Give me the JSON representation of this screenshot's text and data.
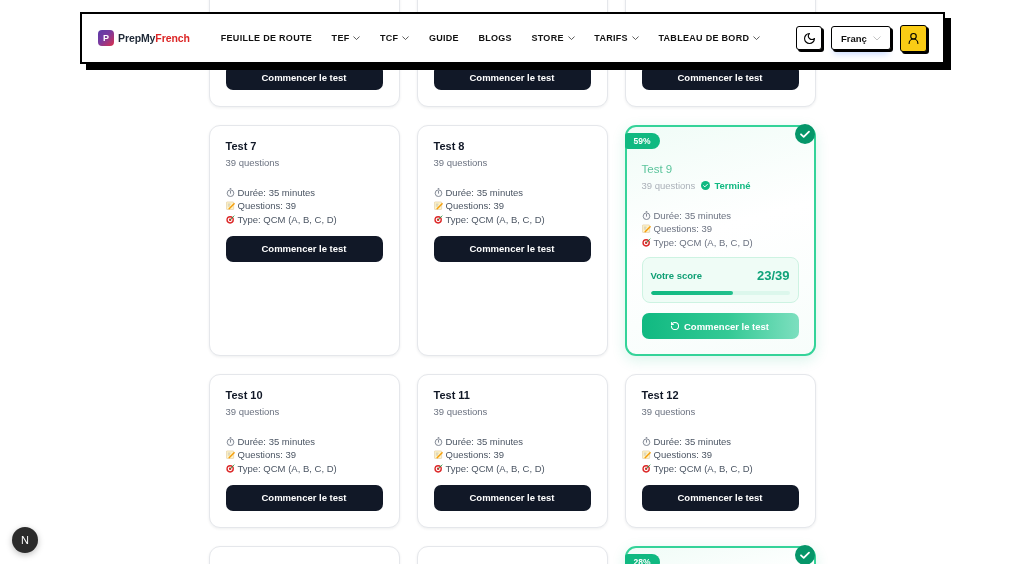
{
  "header": {
    "logo": {
      "mark": "P",
      "brand": "PrepMy",
      "brand_accent": "French"
    },
    "nav": [
      {
        "label": "FEUILLE DE ROUTE",
        "has_menu": false
      },
      {
        "label": "TEF",
        "has_menu": true
      },
      {
        "label": "TCF",
        "has_menu": true
      },
      {
        "label": "GUIDE",
        "has_menu": false
      },
      {
        "label": "BLOGS",
        "has_menu": false
      },
      {
        "label": "STORE",
        "has_menu": true
      },
      {
        "label": "TARIFS",
        "has_menu": true
      },
      {
        "label": "TABLEAU DE BORD",
        "has_menu": true
      }
    ],
    "language": {
      "value": "Franç"
    }
  },
  "tests": [
    {
      "kind": "cut_top",
      "completed": false,
      "button": "Commencer le test"
    },
    {
      "kind": "cut_top",
      "completed": false,
      "button": "Commencer le test"
    },
    {
      "kind": "cut_top",
      "completed": false,
      "button": "Commencer le test"
    },
    {
      "kind": "full",
      "completed": false,
      "title": "Test 7",
      "subtitle": "39 questions",
      "details": [
        {
          "kind": "duration",
          "text": "Durée: 35 minutes"
        },
        {
          "kind": "questions",
          "text": "Questions: 39"
        },
        {
          "kind": "type",
          "text": "Type: QCM (A, B, C, D)"
        }
      ],
      "button": "Commencer le test"
    },
    {
      "kind": "full",
      "completed": false,
      "title": "Test 8",
      "subtitle": "39 questions",
      "details": [
        {
          "kind": "duration",
          "text": "Durée: 35 minutes"
        },
        {
          "kind": "questions",
          "text": "Questions: 39"
        },
        {
          "kind": "type",
          "text": "Type: QCM (A, B, C, D)"
        }
      ],
      "button": "Commencer le test"
    },
    {
      "kind": "full",
      "completed": true,
      "percent": "59%",
      "title": "Test 9",
      "subtitle": "39 questions",
      "status": "Terminé",
      "details": [
        {
          "kind": "duration",
          "text": "Durée: 35 minutes"
        },
        {
          "kind": "questions",
          "text": "Questions: 39"
        },
        {
          "kind": "type",
          "text": "Type: QCM (A, B, C, D)"
        }
      ],
      "score": {
        "label": "Votre score",
        "value": "23/39",
        "level": 0.59
      },
      "button": "Commencer le test"
    },
    {
      "kind": "full",
      "completed": false,
      "title": "Test 10",
      "subtitle": "39 questions",
      "details": [
        {
          "kind": "duration",
          "text": "Durée: 35 minutes"
        },
        {
          "kind": "questions",
          "text": "Questions: 39"
        },
        {
          "kind": "type",
          "text": "Type: QCM (A, B, C, D)"
        }
      ],
      "button": "Commencer le test"
    },
    {
      "kind": "full",
      "completed": false,
      "title": "Test 11",
      "subtitle": "39 questions",
      "details": [
        {
          "kind": "duration",
          "text": "Durée: 35 minutes"
        },
        {
          "kind": "questions",
          "text": "Questions: 39"
        },
        {
          "kind": "type",
          "text": "Type: QCM (A, B, C, D)"
        }
      ],
      "button": "Commencer le test"
    },
    {
      "kind": "full",
      "completed": false,
      "title": "Test 12",
      "subtitle": "39 questions",
      "details": [
        {
          "kind": "duration",
          "text": "Durée: 35 minutes"
        },
        {
          "kind": "questions",
          "text": "Questions: 39"
        },
        {
          "kind": "type",
          "text": "Type: QCM (A, B, C, D)"
        }
      ],
      "button": "Commencer le test"
    },
    {
      "kind": "cut_bottom",
      "completed": false
    },
    {
      "kind": "cut_bottom",
      "completed": false
    },
    {
      "kind": "cut_bottom",
      "completed": true,
      "percent": "28%"
    }
  ],
  "dev_indicator": {
    "label": "N"
  }
}
